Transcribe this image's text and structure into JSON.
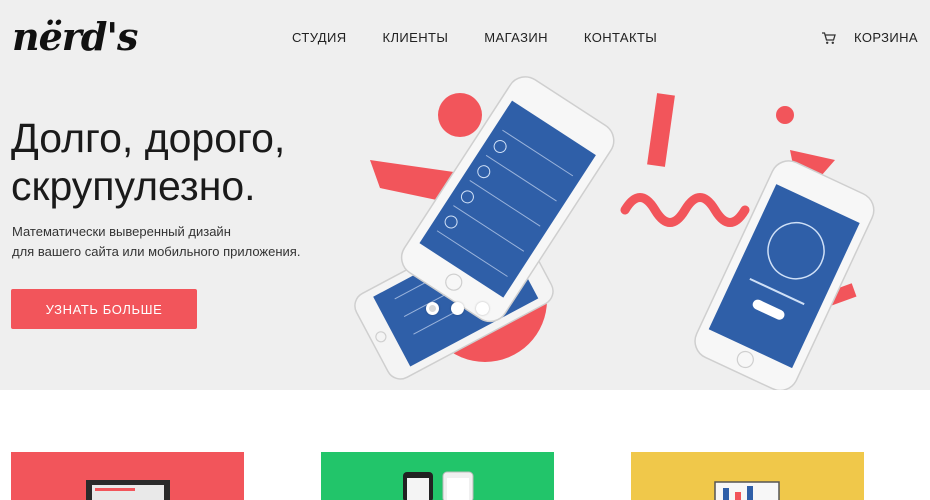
{
  "brand": {
    "logo_text": "nërd's"
  },
  "nav": {
    "items": [
      {
        "label": "СТУДИЯ"
      },
      {
        "label": "КЛИЕНТЫ"
      },
      {
        "label": "МАГАЗИН"
      },
      {
        "label": "КОНТАКТЫ"
      }
    ],
    "cart_label": "КОРЗИНА",
    "cart_icon": "cart-icon"
  },
  "hero": {
    "headline_line1": "Долго, дорого,",
    "headline_line2": "скрупулезно.",
    "sub_line1": "Математически выверенный дизайн",
    "sub_line2": "для вашего сайта или мобильного приложения.",
    "cta_label": "УЗНАТЬ БОЛЬШЕ",
    "slides_count": 3,
    "active_slide": 1
  },
  "colors": {
    "accent": "#f2555b",
    "hero_bg": "#efefef",
    "app_blue": "#2f5fa8",
    "card_red": "#f2555b",
    "card_green": "#22c56a",
    "card_yellow": "#f0c84a"
  }
}
